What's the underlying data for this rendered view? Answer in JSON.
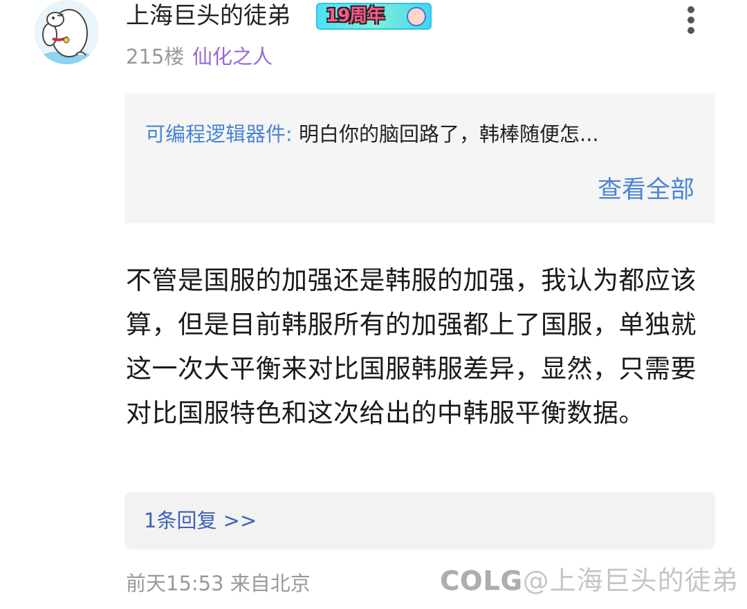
{
  "post": {
    "username": "上海巨头的徒弟",
    "badge_text": "19周年",
    "floor": "215楼",
    "tail": "仙化之人",
    "quote": {
      "author": "可编程逻辑器件:",
      "text": " 明白你的脑回路了，韩棒随便怎...",
      "view_all": "查看全部"
    },
    "content": "不管是国服的加强还是韩服的加强，我认为都应该算，但是目前韩服所有的加强都上了国服，单独就这一次大平衡来对比国服韩服差异，显然，只需要对比国服特色和这次给出的中韩服平衡数据。",
    "replies_label": "1条回复 >>",
    "time_location": "前天15:53 来自北京",
    "watermark_logo": "COLG",
    "watermark_text": "@上海巨头的徒弟"
  }
}
